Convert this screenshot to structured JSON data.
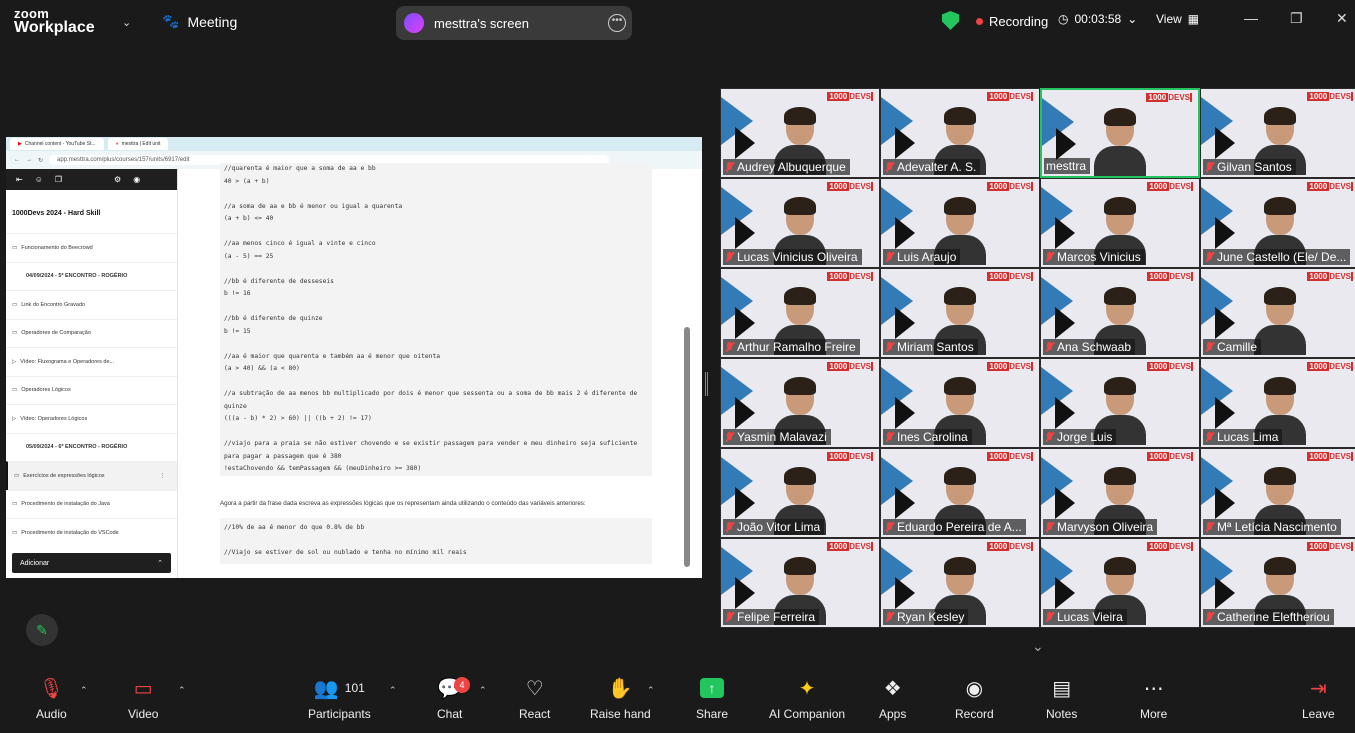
{
  "app": {
    "brand_line1": "zoom",
    "brand_line2": "Workplace",
    "meeting_label": "Meeting"
  },
  "screen_share": {
    "title": "mesttra's screen"
  },
  "status": {
    "recording": "Recording",
    "timer": "00:03:58",
    "view": "View"
  },
  "browser": {
    "tab1": "Channel content - YouTube St...",
    "tab2": "mesttra | Edit unit",
    "url": "app.mesttra.com/plus/courses/157/units/6917/edit"
  },
  "sidebar": {
    "course_title": "1000Devs 2024 - Hard Skill",
    "items": [
      {
        "label": "Funcionamento do Beecrowd",
        "type": "item"
      },
      {
        "label": "04/09/2024 - 5º ENCONTRO - ROGÉRIO",
        "type": "section"
      },
      {
        "label": "Link do Encontro Gravado",
        "type": "item"
      },
      {
        "label": "Operadores de Comparação",
        "type": "item"
      },
      {
        "label": "Vídeo: Fluxograma e Operadores de...",
        "type": "item"
      },
      {
        "label": "Operadores Lógicos",
        "type": "item"
      },
      {
        "label": "Vídeo: Operadores Lógicos",
        "type": "item"
      },
      {
        "label": "05/09/2024 - 6º ENCONTRO - ROGÉRIO",
        "type": "section"
      },
      {
        "label": "Exercícios de expressões lógicos",
        "type": "active"
      },
      {
        "label": "Procedimento de instalação do Java",
        "type": "item"
      },
      {
        "label": "Procedimento de instalação do VSCode",
        "type": "item"
      }
    ],
    "add_button": "Adicionar"
  },
  "editor": {
    "code_lines": [
      "//quarenta é maior que a soma de aa e bb",
      "40 > (a + b)",
      "",
      "//a soma de aa e bb é menor ou igual a quarenta",
      "(a + b) <= 40",
      "",
      "//aa menos cinco é igual a vinte e cinco",
      "(a - 5) == 25",
      "",
      "//bb é diferente de desseseis",
      "b != 16",
      "",
      "//bb é diferente de quinze",
      "b != 15",
      "",
      "//aa é maior que quarenta e também aa é menor que oitenta",
      "(a > 40) && (a < 80)",
      "",
      "//a subtração de aa menos bb multiplicado por dois é menor que sessenta ou a soma de bb mais 2 é diferente de",
      "quinze",
      "(((a - b) * 2) > 60) || ((b + 2) != 17)",
      "",
      "//viajo para a praia se não estiver chovendo e se existir passagem para vender e meu dinheiro seja suficiente",
      "para pagar a passagem que é 380",
      "!estaChovendo && temPassagem && (meuDinheiro >= 380)"
    ],
    "paragraph": "Agora a partir da frase dada escreva as expressões lógicas que os representam ainda utilizando o conteúdo das variáveis anteriores:",
    "code2_lines": [
      "//10% de aa é menor do que 0.8% de bb",
      "",
      "//Viajo se estiver de sol ou nublado e tenha no mínimo mil reais"
    ]
  },
  "participants": [
    "Audrey Albuquerque",
    "Adevalter A. S.",
    "mesttra",
    "Gilvan Santos",
    "Lucas Vinicius Oliveira",
    "Luis Araujo",
    "Marcos Vinicius",
    "June Castello (Ele/ De...",
    "Arthur Ramalho Freire",
    "Miriam Santos",
    "Ana Schwaab",
    "Camille",
    "Yasmin Malavazi",
    "Ines Carolina",
    "Jorge Luis",
    "Lucas Lima",
    "João Vitor Lima",
    "Eduardo Pereira de A...",
    "Marvyson Oliveira",
    "Mª Letícia Nascimento",
    "Felipe Ferreira",
    "Ryan Kesley",
    "Lucas Vieira",
    "Catherine Eleftheriou"
  ],
  "tile_brand": {
    "a": "1000",
    "b": "DEVS"
  },
  "toolbar": {
    "audio": "Audio",
    "video": "Video",
    "participants": "Participants",
    "participants_count": "101",
    "chat": "Chat",
    "chat_badge": "4",
    "react": "React",
    "raise_hand": "Raise hand",
    "share": "Share",
    "ai": "AI Companion",
    "apps": "Apps",
    "record": "Record",
    "notes": "Notes",
    "more": "More",
    "leave": "Leave"
  },
  "colors": {
    "accent_green": "#22c55e",
    "record_red": "#ef4444",
    "brand_red": "#d32f2f"
  }
}
